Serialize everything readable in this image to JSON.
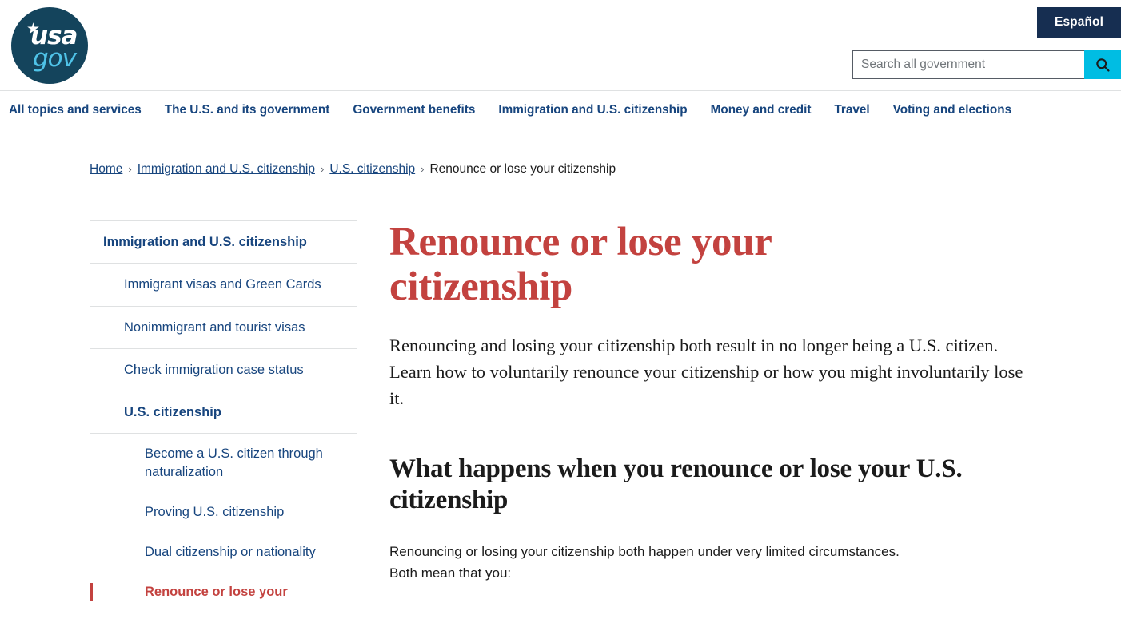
{
  "header": {
    "logo": {
      "star": "★",
      "line1": "usa",
      "line2": "gov"
    },
    "language_button": "Español",
    "search": {
      "placeholder": "Search all government",
      "value": "",
      "icon": "search-icon"
    }
  },
  "nav": {
    "items": [
      {
        "label": "All topics and services"
      },
      {
        "label": "The U.S. and its government"
      },
      {
        "label": "Government benefits"
      },
      {
        "label": "Immigration and U.S. citizenship"
      },
      {
        "label": "Money and credit"
      },
      {
        "label": "Travel"
      },
      {
        "label": "Voting and elections"
      }
    ]
  },
  "breadcrumb": {
    "separator": "›",
    "items": [
      {
        "label": "Home",
        "current": false
      },
      {
        "label": "Immigration and U.S. citizenship",
        "current": false
      },
      {
        "label": "U.S. citizenship",
        "current": false
      },
      {
        "label": "Renounce or lose your citizenship",
        "current": true
      }
    ]
  },
  "sidebar": {
    "items": [
      {
        "label": "Immigration and U.S. citizenship",
        "level": 0,
        "bold": true,
        "active": false,
        "divider": true
      },
      {
        "label": "Immigrant visas and Green Cards",
        "level": 1,
        "bold": false,
        "active": false,
        "divider": true
      },
      {
        "label": "Nonimmigrant and tourist visas",
        "level": 1,
        "bold": false,
        "active": false,
        "divider": true
      },
      {
        "label": "Check immigration case status",
        "level": 1,
        "bold": false,
        "active": false,
        "divider": true
      },
      {
        "label": "U.S. citizenship",
        "level": 1,
        "bold": true,
        "active": false,
        "divider": true
      },
      {
        "label": "Become a U.S. citizen through naturalization",
        "level": 2,
        "bold": false,
        "active": false,
        "divider": false
      },
      {
        "label": "Proving U.S. citizenship",
        "level": 2,
        "bold": false,
        "active": false,
        "divider": false
      },
      {
        "label": "Dual citizenship or nationality",
        "level": 2,
        "bold": false,
        "active": false,
        "divider": false
      },
      {
        "label": "Renounce or lose your",
        "level": 2,
        "bold": true,
        "active": true,
        "divider": false
      }
    ]
  },
  "main": {
    "title": "Renounce or lose your citizenship",
    "lead": "Renouncing and losing your citizenship both result in no longer being a U.S. citizen. Learn how to voluntarily renounce your citizenship or how you might involuntarily lose it.",
    "section_heading": "What happens when you renounce or lose your U.S. citizenship",
    "section_paragraph": "Renouncing or losing your citizenship both happen under very limited circumstances. Both mean that you:"
  },
  "colors": {
    "brand_navy": "#162e51",
    "logo_navy": "#14445c",
    "logo_cyan": "#4fc3e8",
    "link_blue": "#17457e",
    "accent_red": "#c3423f",
    "search_cyan": "#00bde3",
    "border_gray": "#dfe1e2",
    "text": "#1b1b1b"
  }
}
